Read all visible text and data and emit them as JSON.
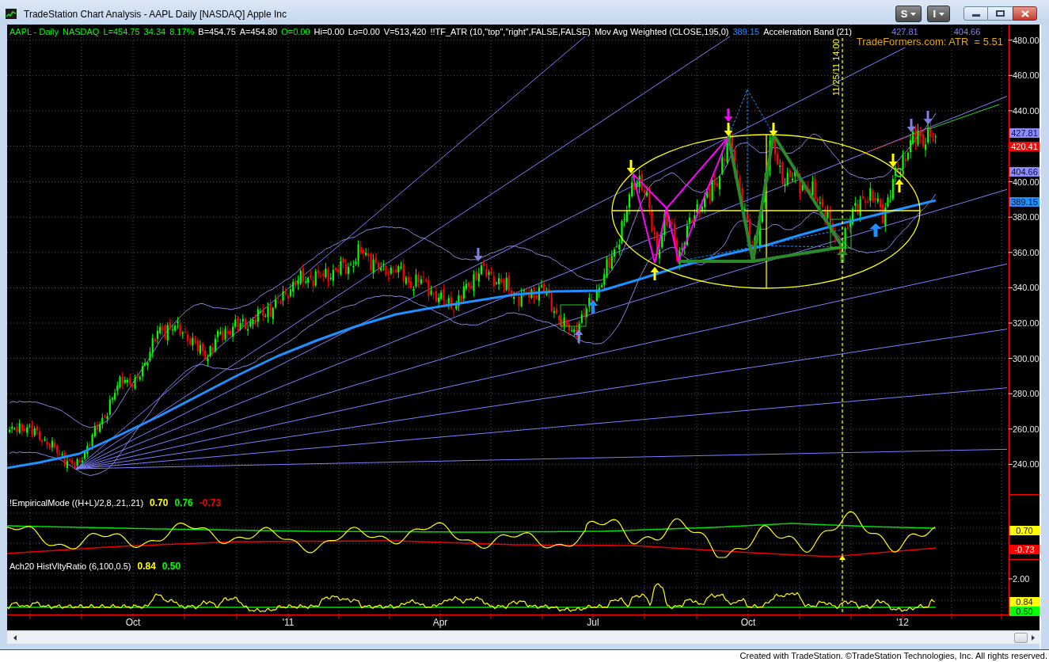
{
  "window": {
    "title": "TradeStation Chart Analysis - AAPL Daily [NASDAQ] Apple Inc",
    "menu_buttons": [
      {
        "label": "S"
      },
      {
        "label": "I"
      }
    ]
  },
  "price_panel": {
    "legend": [
      {
        "text": "AAPL - Daily",
        "color": "#00ff00"
      },
      {
        "text": "NASDAQ",
        "color": "#00ff00"
      },
      {
        "text": "L=454.75",
        "color": "#00ff00"
      },
      {
        "text": "34.34",
        "color": "#00ff00"
      },
      {
        "text": "8.17%",
        "color": "#00ff00"
      },
      {
        "text": "B=454.75",
        "color": "#ffffff"
      },
      {
        "text": "A=454.80",
        "color": "#ffffff"
      },
      {
        "text": "O=0.00",
        "color": "#00ff00"
      },
      {
        "text": "Hi=0.00",
        "color": "#ffffff"
      },
      {
        "text": "Lo=0.00",
        "color": "#ffffff"
      },
      {
        "text": "V=513,420",
        "color": "#ffffff"
      },
      {
        "text": "!!TF_ATR (10,\"top\",\"right\",FALSE,FALSE)",
        "color": "#ffffff"
      },
      {
        "text": "Mov Avg Weighted (CLOSE,195,0)",
        "color": "#ffffff"
      },
      {
        "text": "389.15",
        "color": "#1e90ff"
      },
      {
        "text": "Acceleration Band (21)",
        "color": "#ffffff"
      },
      {
        "text": "427.81",
        "color": "#8080ff"
      },
      {
        "text": "404.66",
        "color": "#8080ff"
      }
    ],
    "atr_label": "TradeFormers.com: ATR  = 5.51",
    "time_marker_label": "11/25/11 14:00"
  },
  "price_axis": {
    "labels": [
      "480.00",
      "460.00",
      "440.00",
      "400.00",
      "380.00",
      "360.00",
      "340.00",
      "320.00",
      "300.00",
      "280.00",
      "260.00",
      "240.00"
    ],
    "markers": [
      {
        "text": "427.81",
        "color": "#8c8cff"
      },
      {
        "text": "420.41",
        "color": "#ff0000"
      },
      {
        "text": "404.66",
        "color": "#8c8cff"
      },
      {
        "text": "389.15",
        "color": "#1e90ff"
      }
    ]
  },
  "empirical_mode_panel": {
    "legend": [
      {
        "text": "!EmpiricalMode ((H+L)/2,8,.21,.21)",
        "color": "#ffffff"
      },
      {
        "text": "0.70",
        "color": "#ffff00"
      },
      {
        "text": "0.76",
        "color": "#00ff00"
      },
      {
        "text": "-0.73",
        "color": "#ff0000"
      }
    ],
    "axis_markers": [
      {
        "text": "0.70",
        "color": "#ffff00"
      },
      {
        "text": "-0.73",
        "color": "#ff0000"
      }
    ]
  },
  "volatility_panel": {
    "legend": [
      {
        "text": "Ach20 HistVltyRatio (6,100,0.5)",
        "color": "#ffffff"
      },
      {
        "text": "0.84",
        "color": "#ffff00"
      },
      {
        "text": "0.50",
        "color": "#00ff00"
      }
    ],
    "axis_labels": [
      "2.00"
    ],
    "axis_markers": [
      {
        "text": "0.84",
        "color": "#ffff00"
      },
      {
        "text": "0.50",
        "color": "#00ff00"
      }
    ]
  },
  "time_axis": {
    "labels": [
      "Oct",
      "'11",
      "Apr",
      "Jul",
      "Oct",
      "'12"
    ]
  },
  "footer": "Created with TradeStation. ©TradeStation Technologies, Inc. All rights reserved."
}
